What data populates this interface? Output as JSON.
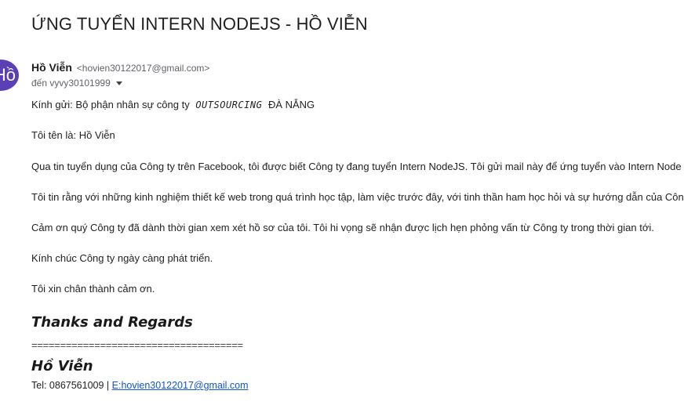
{
  "subject": "ỨNG TUYỂN INTERN NODEJS - HỒ VIỄN",
  "avatar": {
    "initials": "Hồ",
    "color": "#5b3fb5"
  },
  "sender": {
    "name": "Hồ Viễn",
    "email": "<hovien30122017@gmail.com>"
  },
  "recipient": {
    "text": "đến vyvy30101999"
  },
  "body": {
    "greeting_prefix": "Kính gửi: Bộ phận nhân sự công ty",
    "greeting_company": "OUTSOURCING",
    "greeting_suffix": "ĐÀ NẴNG",
    "intro": "Tôi tên là: Hồ Viễn",
    "paragraph_1": "Qua tin tuyển dụng của Công ty trên Facebook, tôi được biết Công ty đang tuyển Intern NodeJS. Tôi gửi mail này để ứng tuyển vào  Intern Node",
    "paragraph_2": "Tôi tin rằng với những kinh nghiệm thiết kế web trong quá trình học tập, làm việc trước đây, với tinh thần ham học hỏi và sự hướng dẫn của Côn",
    "paragraph_3": "Cảm ơn quý Công ty đã dành thời gian xem xét hồ sơ của tôi. Tôi hi vọng sẽ nhận được lịch hẹn phỏng vấn từ Công ty trong thời gian tới.",
    "paragraph_4": "Kính chúc Công ty ngày càng phát triển.",
    "closing": "Tôi xin chân thành cảm ơn."
  },
  "signature": {
    "thanks": "Thanks and Regards",
    "divider": "=====================================",
    "name": "Hồ Viễn",
    "contact_prefix": "Tel: 0867561009 | ",
    "email_link": "E:hovien30122017@gmail.com"
  },
  "colors": {
    "link": "#1155cc",
    "avatar": "#5b3fb5",
    "meta_text": "#5f6368"
  }
}
